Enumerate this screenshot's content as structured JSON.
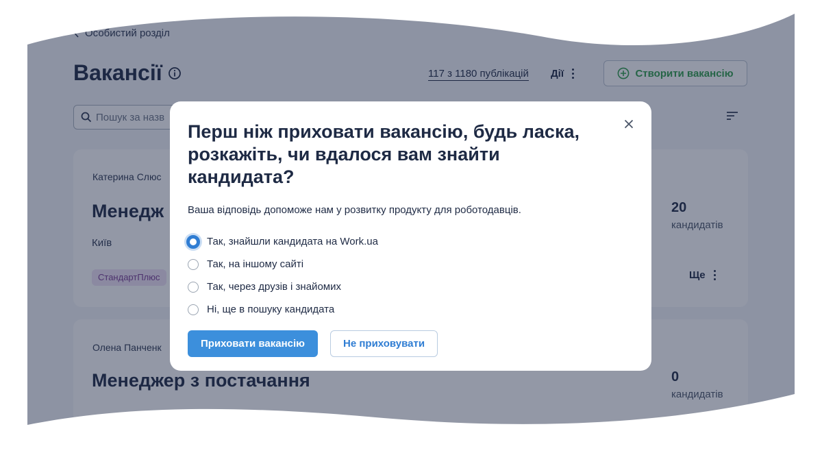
{
  "header": {
    "back_label": "Особистий розділ",
    "title": "Вакансії",
    "publications": "117 з 1180 публікацій",
    "actions_label": "Дії",
    "create_label": "Створити вакансію"
  },
  "search": {
    "placeholder": "Пошук за назв"
  },
  "vacancies": [
    {
      "owner": "Катерина Слюс",
      "title": "Менедж",
      "city": "Київ",
      "badge": "СтандартПлюс",
      "count": "20",
      "count_label": "кандидатів",
      "more_label": "Ще"
    },
    {
      "owner": "Олена Панченк",
      "title": "Менеджер з постачання",
      "count": "0",
      "count_label": "кандидатів"
    }
  ],
  "modal": {
    "title": "Перш ніж приховати вакансію, будь ласка, розкажіть, чи вдалося вам знайти кандидата?",
    "subtitle": "Ваша відповідь допоможе нам у розвитку продукту для роботодавців.",
    "options": [
      {
        "label": "Так, знайшли кандидата на Work.ua",
        "selected": true
      },
      {
        "label": "Так, на іншому сайті",
        "selected": false
      },
      {
        "label": "Так, через друзів і знайомих",
        "selected": false
      },
      {
        "label": "Ні, ще в пошуку кандидата",
        "selected": false
      }
    ],
    "primary_label": "Приховати вакансію",
    "secondary_label": "Не приховувати"
  },
  "colors": {
    "accent": "#3c8fdc",
    "create_green": "#2e9d4a",
    "badge_bg": "#efe2f6",
    "overlay": "#1e2846"
  }
}
